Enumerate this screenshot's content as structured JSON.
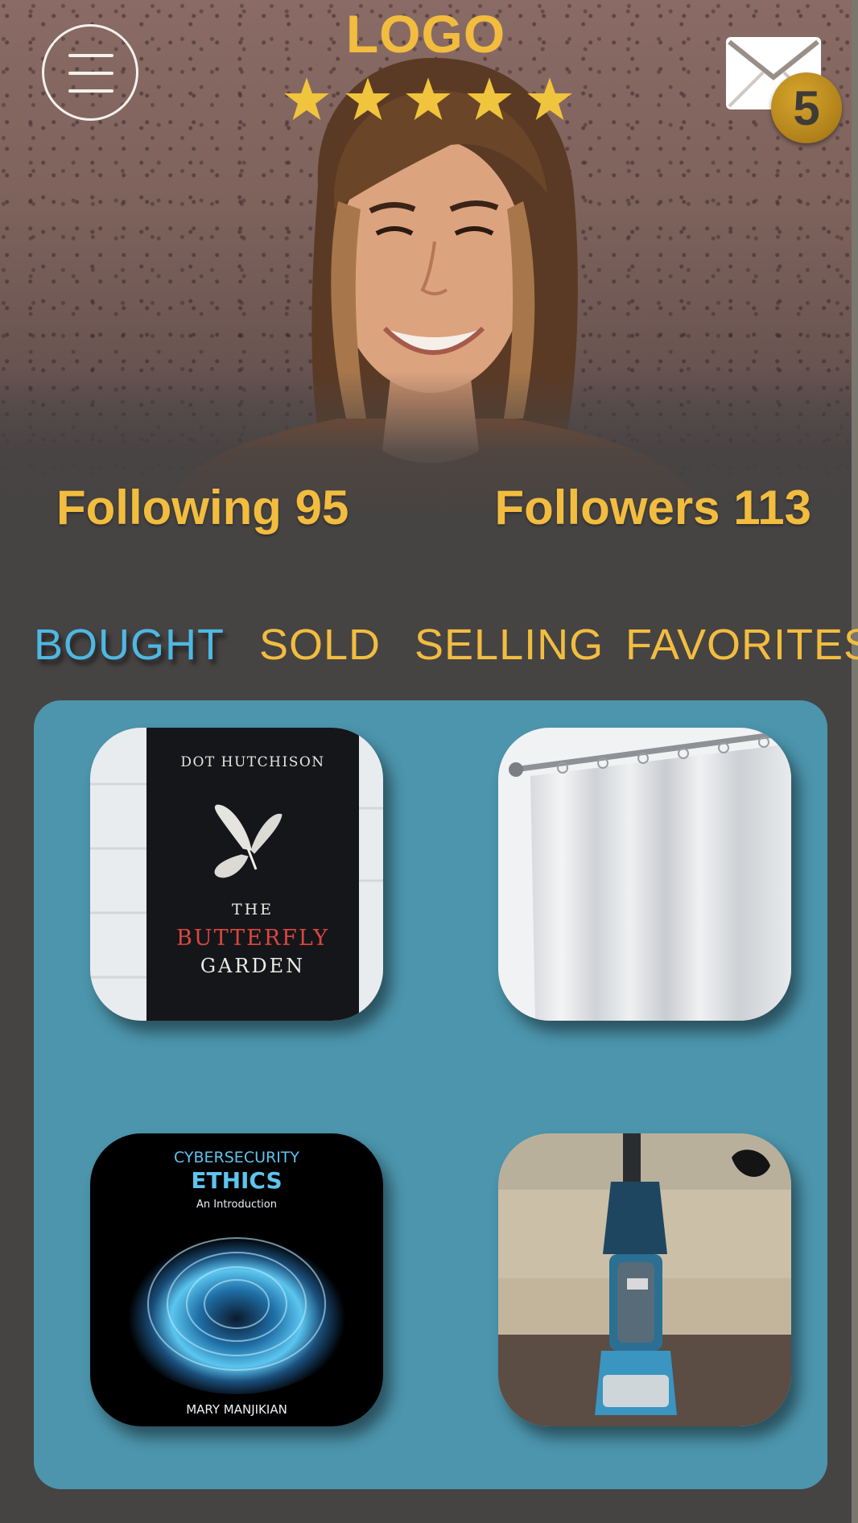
{
  "header": {
    "logo_text": "LOGO",
    "rating_stars": 5,
    "unread_messages": "5"
  },
  "profile": {
    "following_label": "Following 95",
    "followers_label": "Followers 113"
  },
  "tabs": [
    {
      "label": "BOUGHT",
      "active": true
    },
    {
      "label": "SOLD",
      "active": false
    },
    {
      "label": "SELLING",
      "active": false
    },
    {
      "label": "FAVORITES",
      "active": false
    }
  ],
  "items": [
    {
      "author": "DOT HUTCHISON",
      "title_line1": "THE",
      "title_line2": "BUTTERFLY",
      "title_line3": "GARDEN"
    },
    {
      "product": "shower-curtain"
    },
    {
      "title_line1": "CYBERSECURITY",
      "title_line2": "ETHICS",
      "subtitle": "An Introduction",
      "author": "MARY MANJIKIAN"
    },
    {
      "product": "upright-vacuum"
    }
  ],
  "colors": {
    "accent_gold": "#f2bd3f",
    "active_tab": "#4eb8e2",
    "panel_teal": "#4c95ad",
    "background": "#464343"
  }
}
